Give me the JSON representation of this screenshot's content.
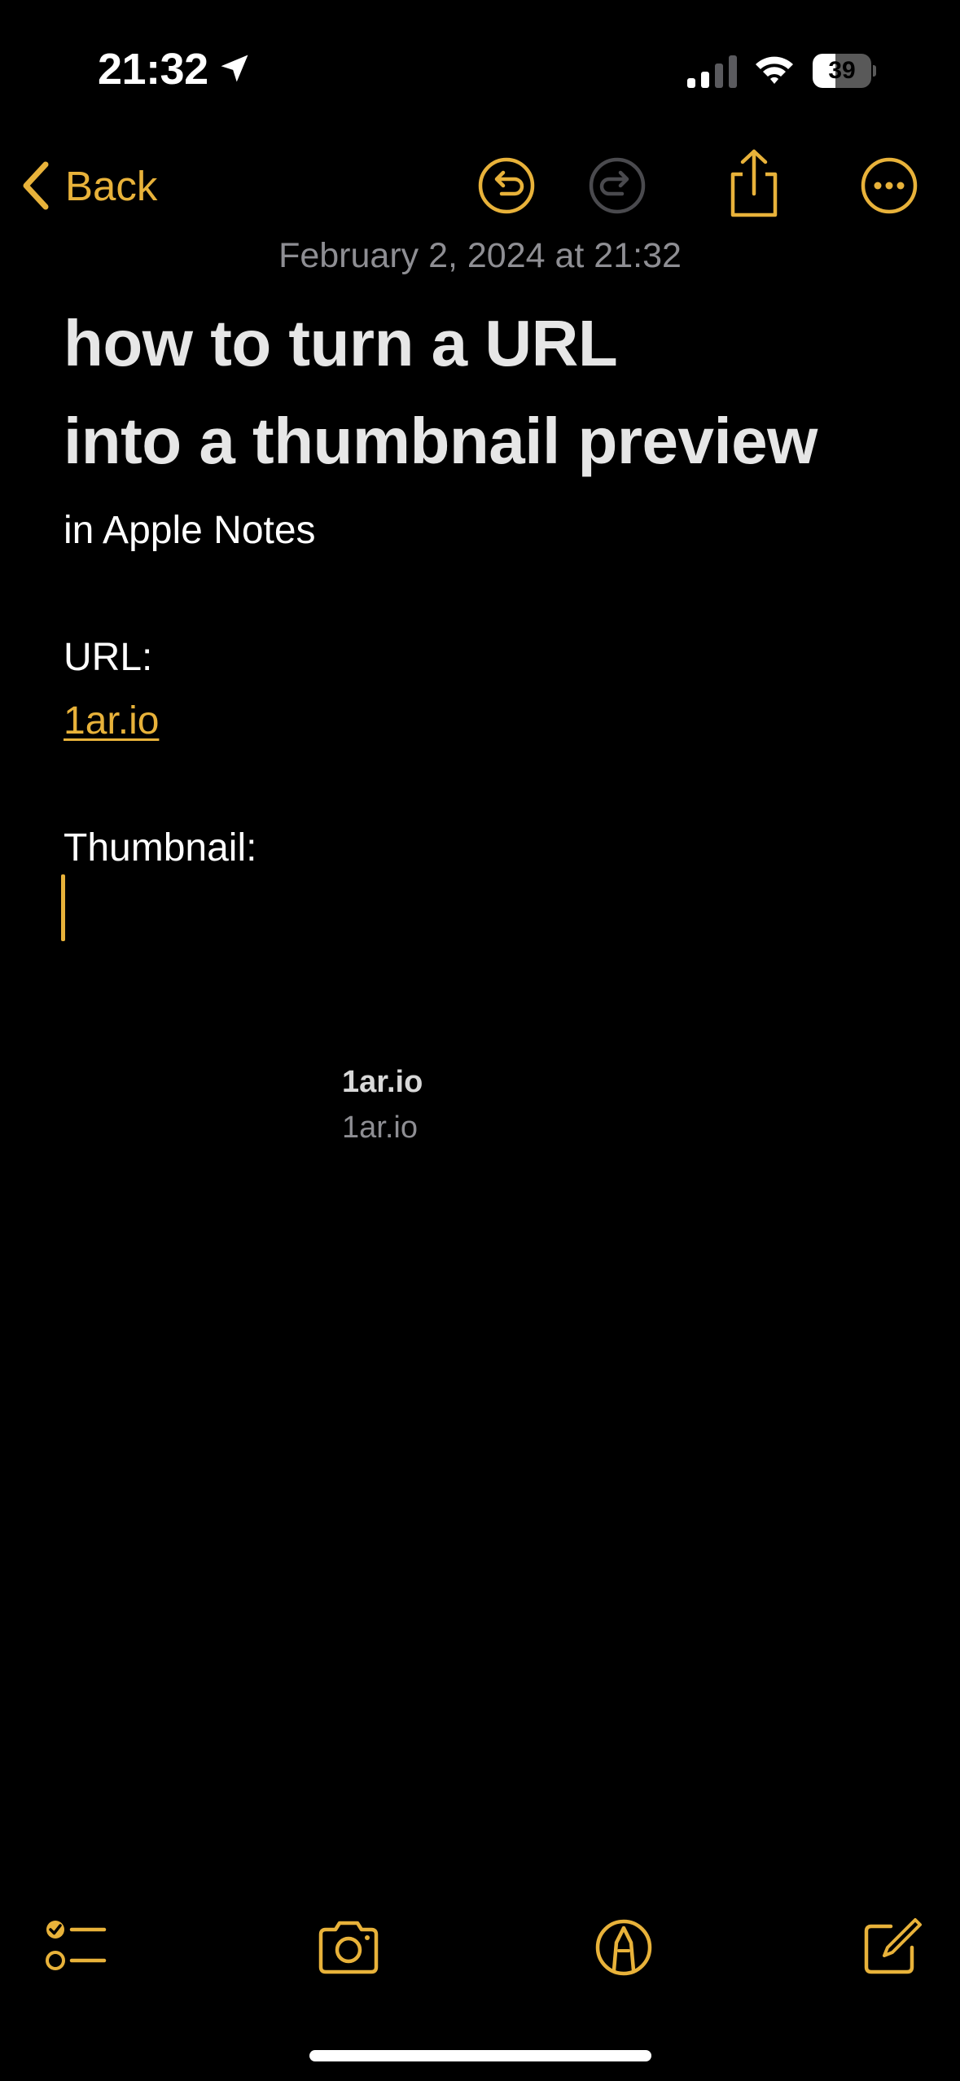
{
  "status_bar": {
    "time": "21:32",
    "battery_level": "39",
    "battery_fraction": 0.39,
    "icons": [
      "location-arrow-icon",
      "cellular-signal-icon",
      "wifi-icon",
      "battery-icon"
    ]
  },
  "nav": {
    "back_label": "Back",
    "icons": [
      "chevron-left-icon",
      "undo-icon",
      "redo-icon",
      "share-icon",
      "more-icon"
    ]
  },
  "note": {
    "date": "February 2, 2024 at 21:32",
    "title_line_1": "how to turn a URL",
    "title_line_2": "into a thumbnail preview",
    "subtitle": "in Apple Notes",
    "url_label": "URL:",
    "url_link": "1ar.io",
    "thumbnail_label": "Thumbnail:",
    "link_preview": {
      "title": "1ar.io",
      "domain": "1ar.io"
    }
  },
  "toolbar": {
    "icons": [
      "checklist-icon",
      "camera-icon",
      "markup-icon",
      "compose-icon"
    ]
  },
  "colors": {
    "accent": "#E8B23A",
    "background": "#000000",
    "secondary_text": "#8e8e93",
    "disabled_icon": "#4a4a4e"
  }
}
